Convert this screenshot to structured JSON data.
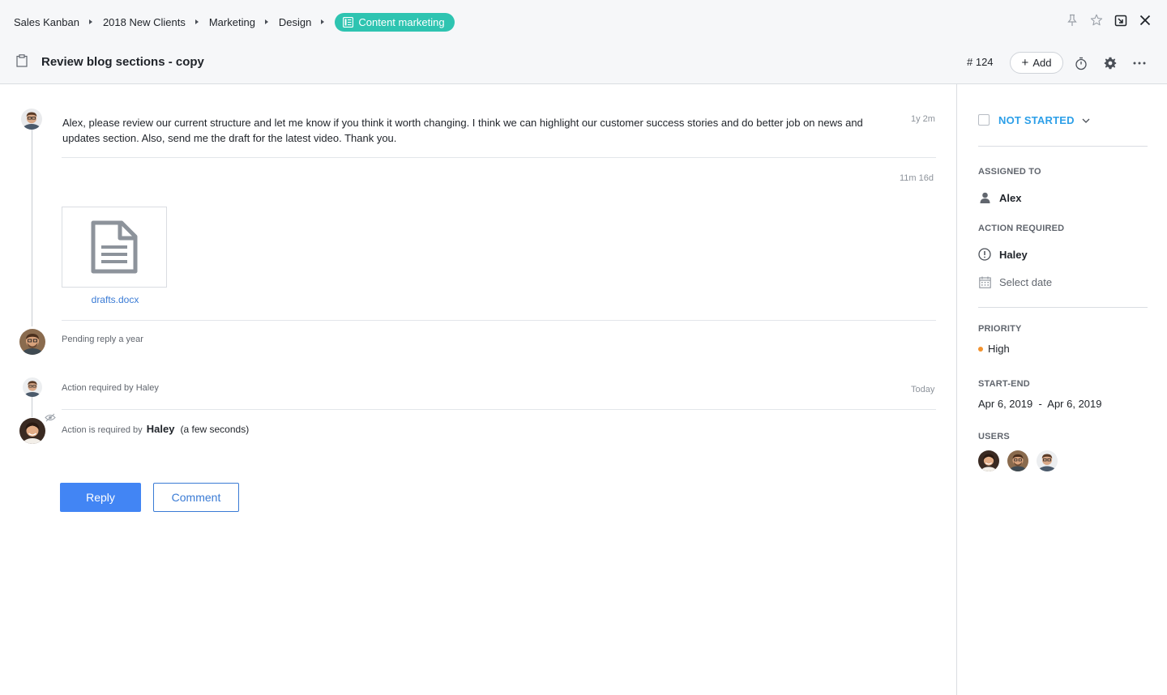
{
  "breadcrumb": [
    "Sales Kanban",
    "2018 New Clients",
    "Marketing",
    "Design"
  ],
  "tag": {
    "label": "Content marketing",
    "color": "#2ec4b1"
  },
  "task": {
    "title": "Review blog sections - copy",
    "id": "# 124",
    "add_label": "Add"
  },
  "feed": {
    "message": {
      "text": "Alex, please review our current structure and let me know if you think it worth changing. I think we can highlight our customer success stories and do better job on news and updates section. Also, send me the draft for the latest video. Thank you.",
      "time": "1y 2m"
    },
    "attachment": {
      "time": "11m 16d",
      "file_name": "drafts.docx"
    },
    "pending": {
      "text": "Pending reply a year"
    },
    "action_event": {
      "text": "Action required by Haley",
      "time": "Today"
    },
    "action_required": {
      "prefix": "Action is required by",
      "name": "Haley",
      "suffix": "(a few seconds)"
    },
    "reply_label": "Reply",
    "comment_label": "Comment"
  },
  "sidebar": {
    "status": "NOT STARTED",
    "assigned_label": "ASSIGNED TO",
    "assigned_to": "Alex",
    "action_label": "ACTION REQUIRED",
    "action_user": "Haley",
    "date_placeholder": "Select date",
    "priority_label": "PRIORITY",
    "priority": "High",
    "priority_color": "#f2922e",
    "start_end_label": "START-END",
    "start_end": "Apr 6, 2019  -  Apr 6, 2019",
    "users_label": "USERS"
  },
  "colors": {
    "accent_blue": "#4285f4",
    "status_blue": "#2c9fe8",
    "link_blue": "#3a7bd5"
  }
}
